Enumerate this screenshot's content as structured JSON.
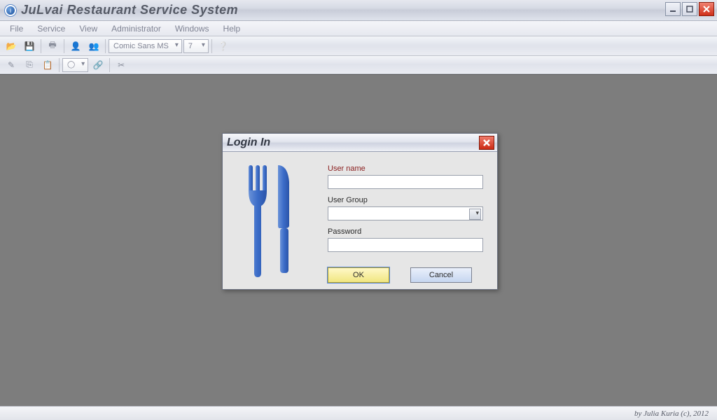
{
  "window": {
    "title": "JuLvai Restaurant Service System"
  },
  "menu": {
    "file": "File",
    "service": "Service",
    "view": "View",
    "administrator": "Administrator",
    "windows": "Windows",
    "help": "Help"
  },
  "toolbar": {
    "font_name": "Comic Sans MS",
    "font_size": "7"
  },
  "dialog": {
    "title": "Login In",
    "username_label": "User name",
    "username_value": "",
    "usergroup_label": "User Group",
    "usergroup_value": "",
    "password_label": "Password",
    "password_value": "",
    "ok_label": "OK",
    "cancel_label": "Cancel"
  },
  "statusbar": {
    "credit": "by Julia Kuria (c), 2012"
  }
}
